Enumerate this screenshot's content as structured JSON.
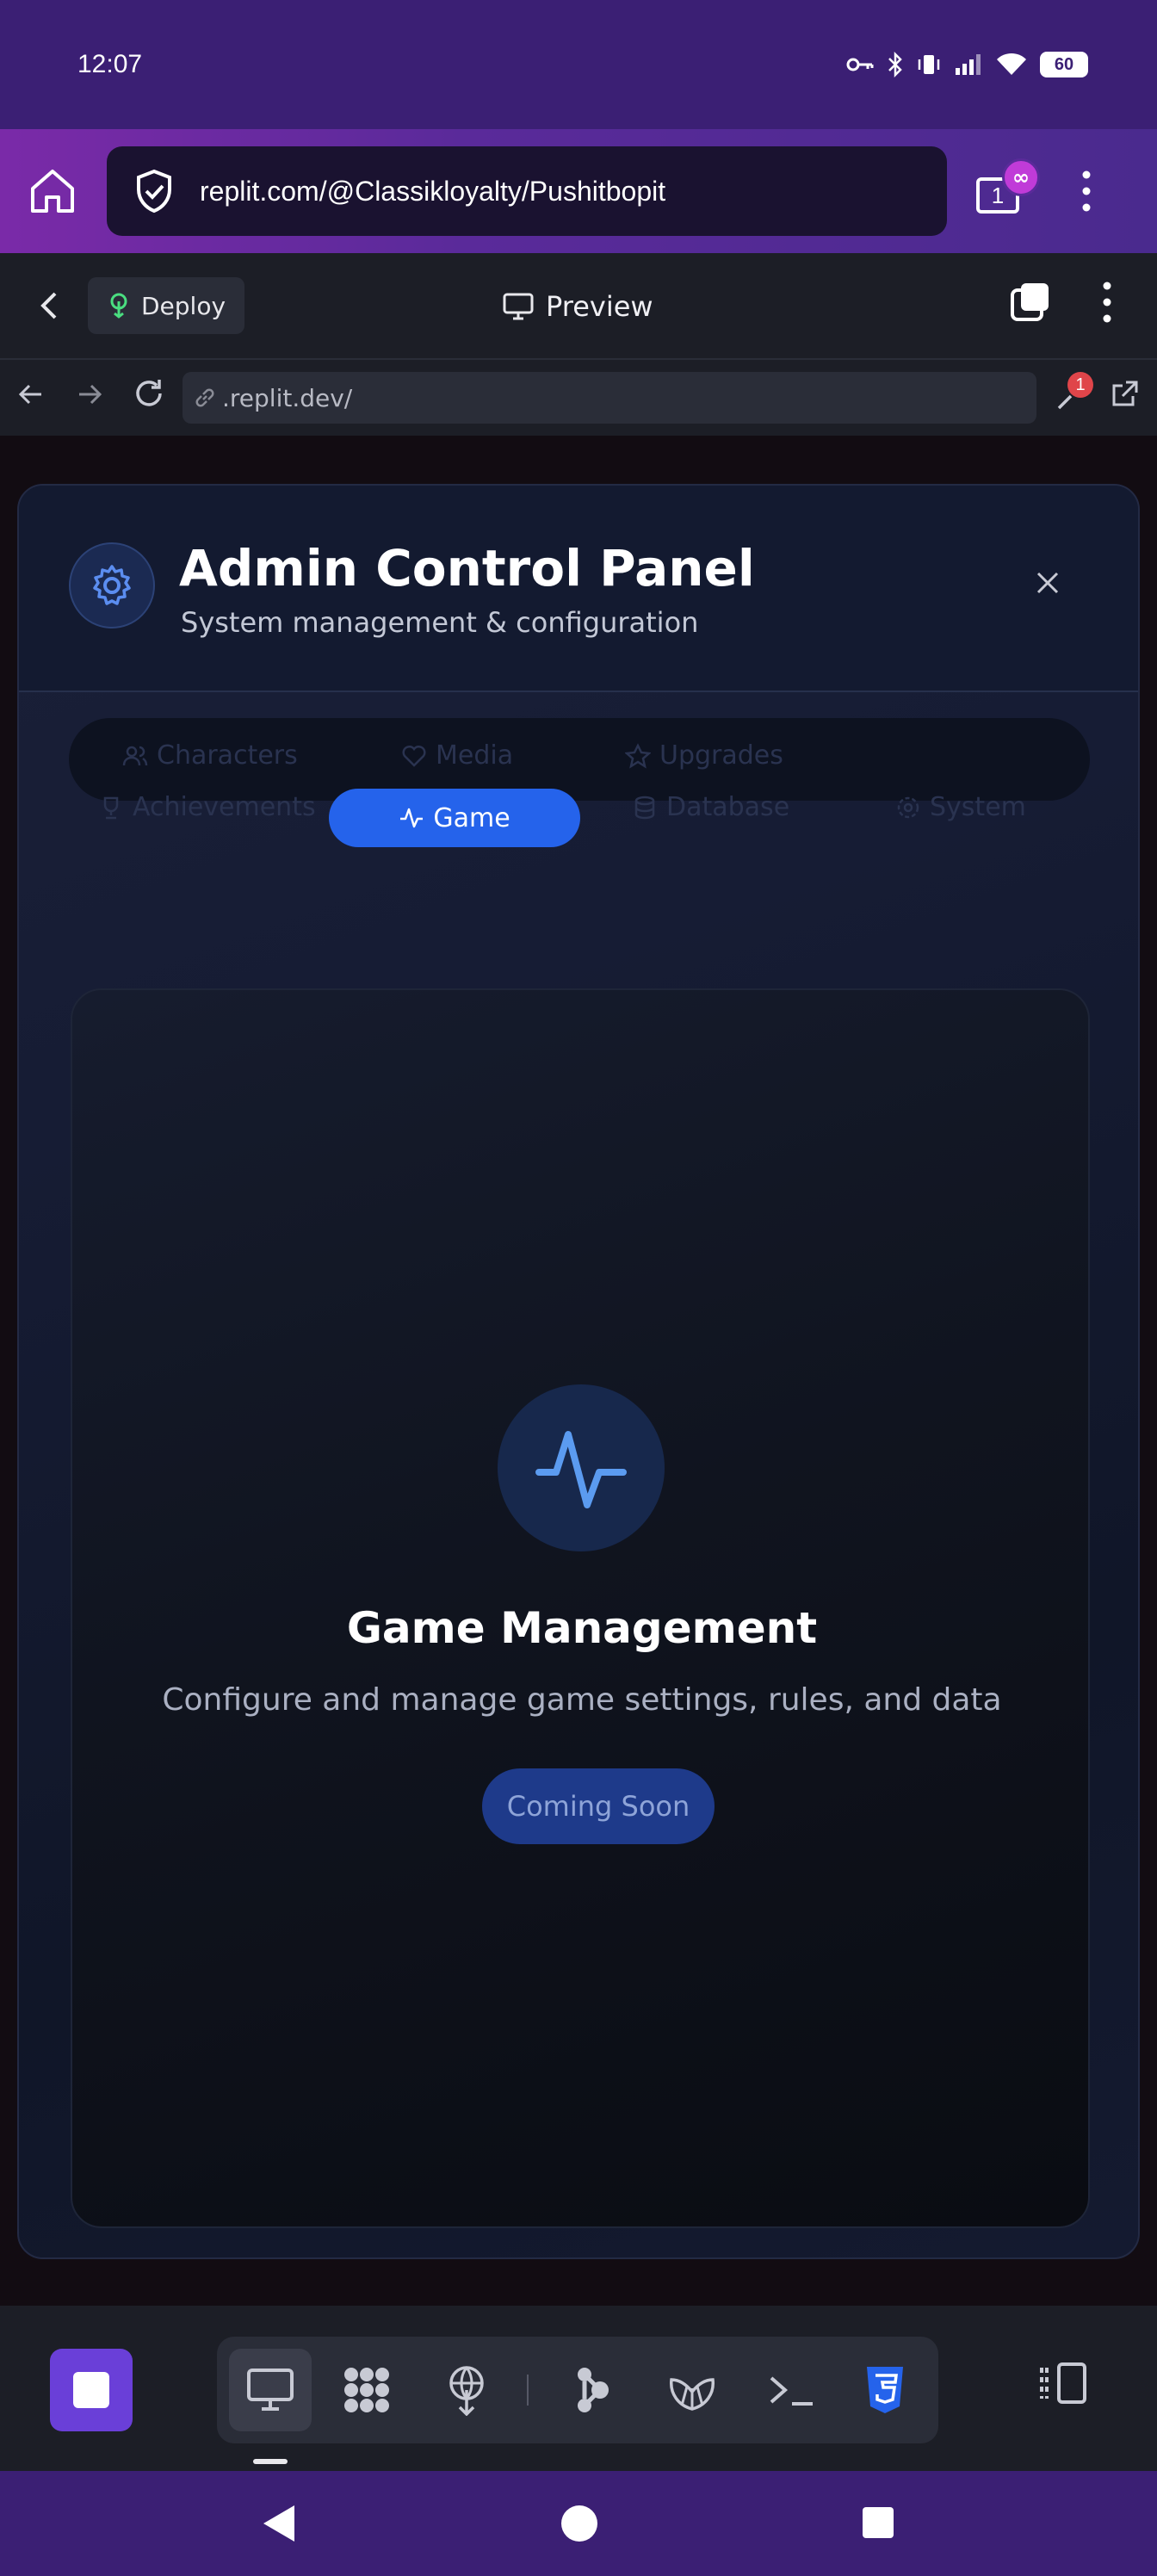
{
  "status_bar": {
    "time": "12:07",
    "battery": "60"
  },
  "browser": {
    "url": "replit.com/@Classikloyalty/Pushitbopit",
    "tab_count": "1",
    "tab_badge": "∞"
  },
  "replit_header": {
    "deploy_label": "Deploy",
    "preview_label": "Preview"
  },
  "webview_nav": {
    "address": ".replit.dev/",
    "devtools_badge": "1"
  },
  "modal": {
    "title": "Admin Control Panel",
    "subtitle": "System management & configuration",
    "tabs": [
      {
        "label": "Characters",
        "icon": "users-icon"
      },
      {
        "label": "Media",
        "icon": "heart-icon"
      },
      {
        "label": "Upgrades",
        "icon": "star-icon"
      },
      {
        "label": "Achievements",
        "icon": "trophy-icon"
      },
      {
        "label": "Game",
        "icon": "activity-icon"
      },
      {
        "label": "Database",
        "icon": "database-icon"
      },
      {
        "label": "System",
        "icon": "gear-icon"
      }
    ],
    "active_tab": "Game"
  },
  "card": {
    "title": "Game Management",
    "description": "Configure and manage game settings, rules, and data",
    "button_label": "Coming Soon"
  },
  "bottom_toolbar": {
    "tools": [
      "preview-icon",
      "apps-icon",
      "deploy-icon",
      "agent-icon",
      "shell-icon",
      "console-icon",
      "css-icon"
    ],
    "active_tool": "preview-icon"
  },
  "colors": {
    "accent": "#2563eb",
    "status_bar": "#3b1f74",
    "stop_button": "#6a3fd8"
  }
}
